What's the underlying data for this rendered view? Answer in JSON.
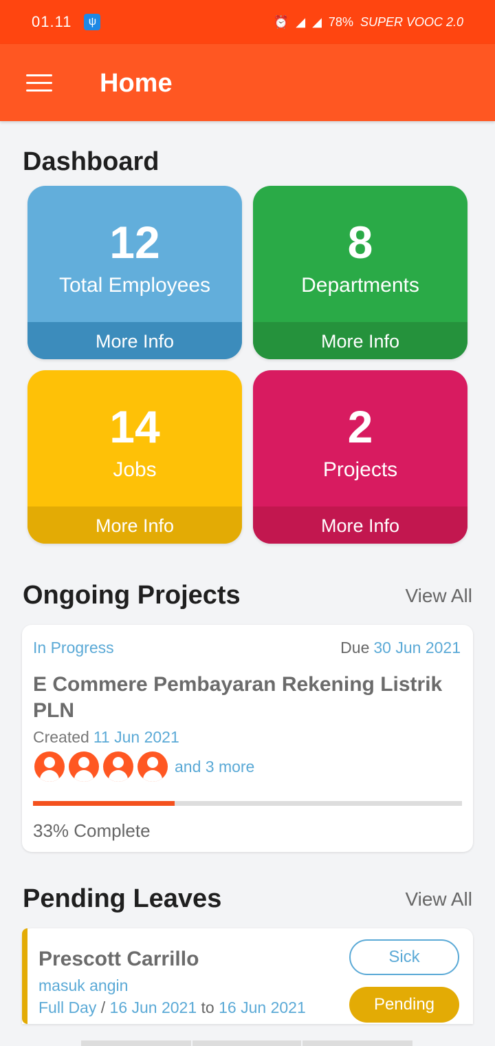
{
  "status_bar": {
    "time": "01.11",
    "battery": "78%",
    "charging": "SUPER VOOC 2.0"
  },
  "app_bar": {
    "title": "Home"
  },
  "dashboard": {
    "title": "Dashboard",
    "cards": [
      {
        "value": "12",
        "label": "Total Employees",
        "more": "More Info",
        "color": "#62aedb"
      },
      {
        "value": "8",
        "label": "Departments",
        "more": "More Info",
        "color": "#2aaa47"
      },
      {
        "value": "14",
        "label": "Jobs",
        "more": "More Info",
        "color": "#fec107"
      },
      {
        "value": "2",
        "label": "Projects",
        "more": "More Info",
        "color": "#d81b60"
      }
    ]
  },
  "ongoing": {
    "title": "Ongoing Projects",
    "view_all": "View All",
    "project": {
      "status": "In Progress",
      "due_label": "Due",
      "due_date": "30 Jun 2021",
      "name": "E Commere Pembayaran Rekening Listrik PLN",
      "created_label": "Created",
      "created_date": "11 Jun 2021",
      "more_members": "and 3 more",
      "progress": 0.33,
      "complete_text": "33% Complete"
    }
  },
  "leaves": {
    "title": "Pending Leaves",
    "view_all": "View All",
    "item": {
      "name": "Prescott Carrillo",
      "reason": "masuk angin",
      "type": "Full Day",
      "from": "16 Jun 2021",
      "to_label": "to",
      "to": "16 Jun 2021",
      "leave_type": "Sick",
      "status": "Pending"
    }
  }
}
